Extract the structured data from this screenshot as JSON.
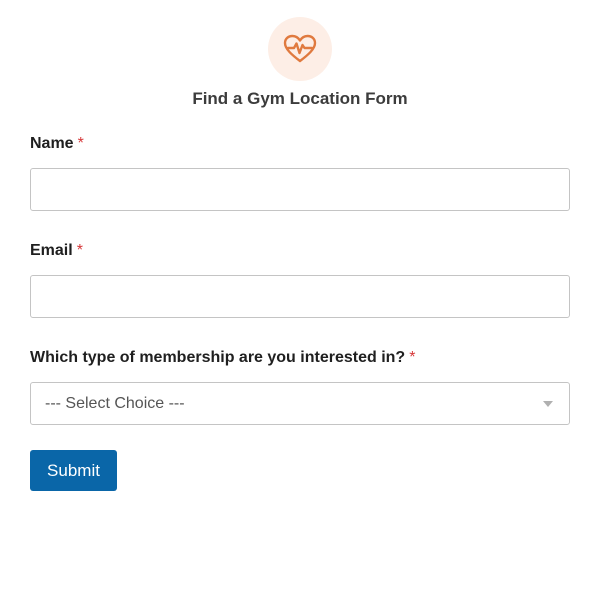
{
  "form": {
    "title": "Find a Gym Location Form",
    "icon": "heart-pulse-icon",
    "accent_color": "#e07a3f",
    "required_marker": "*",
    "fields": {
      "name": {
        "label": "Name",
        "value": "",
        "placeholder": ""
      },
      "email": {
        "label": "Email",
        "value": "",
        "placeholder": ""
      },
      "membership": {
        "label": "Which type of membership are you interested in?",
        "selected": "--- Select Choice ---"
      }
    },
    "submit_label": "Submit",
    "submit_color": "#0a66a8"
  }
}
